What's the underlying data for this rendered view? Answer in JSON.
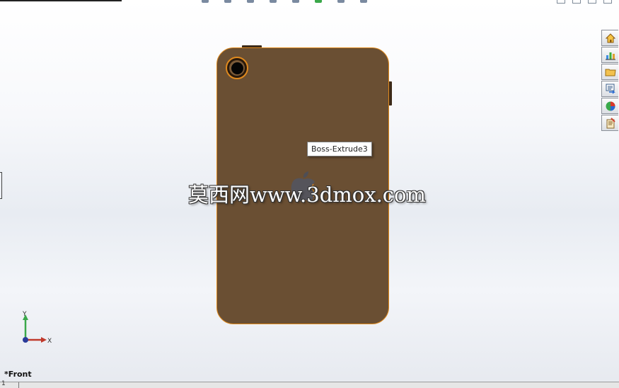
{
  "tooltip": {
    "text": "Boss-Extrude3"
  },
  "watermark": {
    "text": "莫西网www.3dmox.com"
  },
  "view": {
    "label": "*Front"
  },
  "triad": {
    "y_label": "Y",
    "x_label": "X"
  },
  "status": {
    "sheet_number": "1"
  },
  "task_pane": {
    "tabs": [
      {
        "name": "home-icon"
      },
      {
        "name": "resources-icon"
      },
      {
        "name": "design-library-icon"
      },
      {
        "name": "file-explorer-icon"
      },
      {
        "name": "view-palette-icon"
      },
      {
        "name": "custom-properties-icon"
      }
    ]
  },
  "colors": {
    "body": "#6a4f33",
    "edge_highlight": "#e08a1e",
    "background": "#e8ecf2"
  }
}
